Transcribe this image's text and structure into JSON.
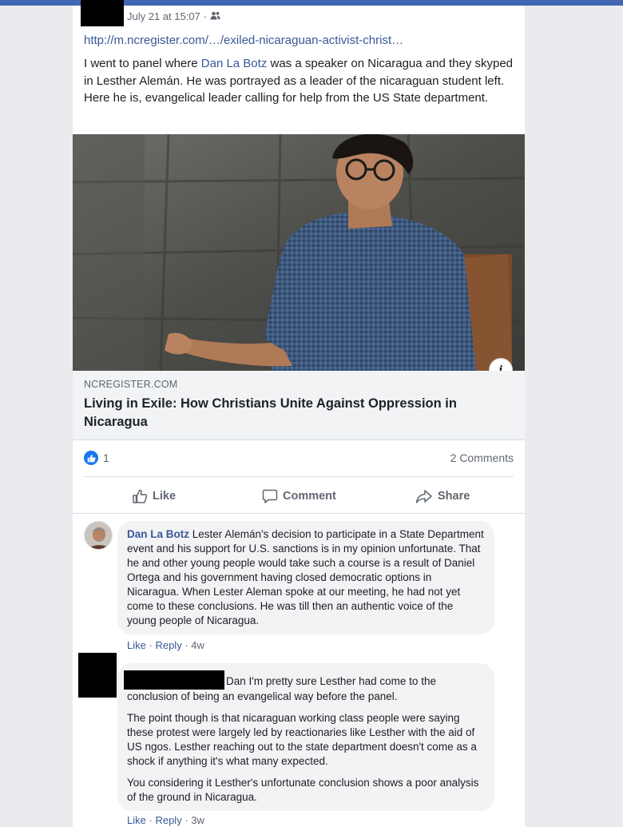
{
  "post": {
    "timestamp": "July 21 at 15:07",
    "separator": "·",
    "audience_icon": "friends-icon",
    "link_url": "http://m.ncregister.com/…/exiled-nicaraguan-activist-christ…",
    "text_before": "I went to panel where ",
    "mention": "Dan La Botz",
    "text_after": " was a speaker on Nicaragua and they skyped in Lesther Alemán. He was portrayed as a leader of the nicaraguan student left. Here he is, evangelical leader calling for help from the US State department."
  },
  "link_preview": {
    "domain": "NCREGISTER.COM",
    "headline": "Living in Exile: How Christians Unite Against Oppression in Nicaragua",
    "info_icon": "i"
  },
  "stats": {
    "likes": "1",
    "comments": "2 Comments"
  },
  "actions": {
    "like": "Like",
    "comment": "Comment",
    "share": "Share"
  },
  "comments": [
    {
      "author": "Dan La Botz",
      "text": " Lester Alemán's decision to participate in a State Department event and his support for U.S. sanctions is in my opinion unfortunate. That he and other young people would take such a course is a result of Daniel Ortega and his government having closed democratic options in Nicaragua. When Lester Aleman spoke at our meeting, he had not yet come to these conclusions. He was till then an authentic voice of the young people of Nicaragua.",
      "like": "Like",
      "reply": "Reply",
      "dot": "·",
      "time": "4w"
    },
    {
      "author": "",
      "paragraphs": [
        "Dan I'm pretty sure Lesther had come to the conclusion of being an evangelical way before the panel.",
        "The point though is that nicaraguan working class people were saying these protest were largely led by reactionaries like Lesther with the aid of US ngos. Lesther reaching out to the state department doesn't come as a shock if anything it's what many expected.",
        "You considering it Lesther's unfortunate conclusion shows a poor analysis of the ground in Nicaragua."
      ],
      "like": "Like",
      "reply": "Reply",
      "dot": "·",
      "time": "3w"
    }
  ],
  "colors": {
    "link": "#385898",
    "like_blue": "#1877f2",
    "bubble": "#f2f3f5",
    "secondary_text": "#606770"
  }
}
